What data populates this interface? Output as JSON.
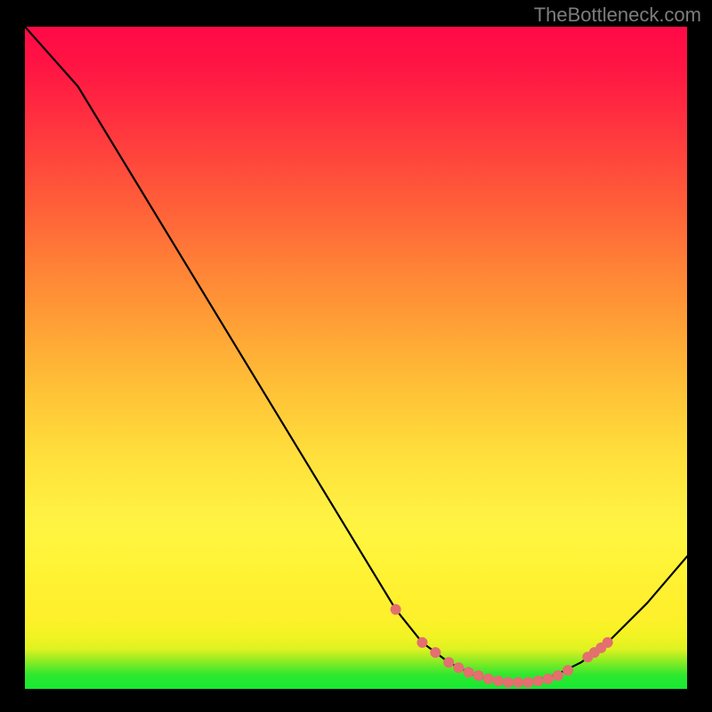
{
  "attribution": "TheBottleneck.com",
  "chart_data": {
    "type": "line",
    "title": "",
    "xlabel": "",
    "ylabel": "",
    "xlim": [
      0,
      1
    ],
    "ylim": [
      0,
      1
    ],
    "series": [
      {
        "name": "curve",
        "x": [
          0.0,
          0.08,
          0.56,
          0.6,
          0.64,
          0.68,
          0.72,
          0.76,
          0.8,
          0.84,
          0.88,
          0.94,
          1.0
        ],
        "y": [
          1.0,
          0.91,
          0.12,
          0.07,
          0.04,
          0.02,
          0.01,
          0.01,
          0.02,
          0.04,
          0.07,
          0.13,
          0.2
        ]
      }
    ],
    "markers": {
      "name": "highlighted-points",
      "color": "#e36f6f",
      "x": [
        0.56,
        0.6,
        0.62,
        0.64,
        0.655,
        0.67,
        0.685,
        0.7,
        0.715,
        0.73,
        0.745,
        0.76,
        0.775,
        0.79,
        0.805,
        0.82,
        0.85,
        0.86,
        0.87,
        0.88
      ],
      "y": [
        0.12,
        0.07,
        0.055,
        0.04,
        0.032,
        0.025,
        0.02,
        0.015,
        0.012,
        0.01,
        0.01,
        0.01,
        0.012,
        0.015,
        0.02,
        0.028,
        0.048,
        0.055,
        0.062,
        0.07
      ]
    },
    "gradient_stops": [
      {
        "pos": 0.0,
        "color": "#17e833"
      },
      {
        "pos": 0.06,
        "color": "#dff221"
      },
      {
        "pos": 0.18,
        "color": "#fff335"
      },
      {
        "pos": 0.5,
        "color": "#ffb136"
      },
      {
        "pos": 0.8,
        "color": "#ff463c"
      },
      {
        "pos": 1.0,
        "color": "#ff0a47"
      }
    ]
  }
}
